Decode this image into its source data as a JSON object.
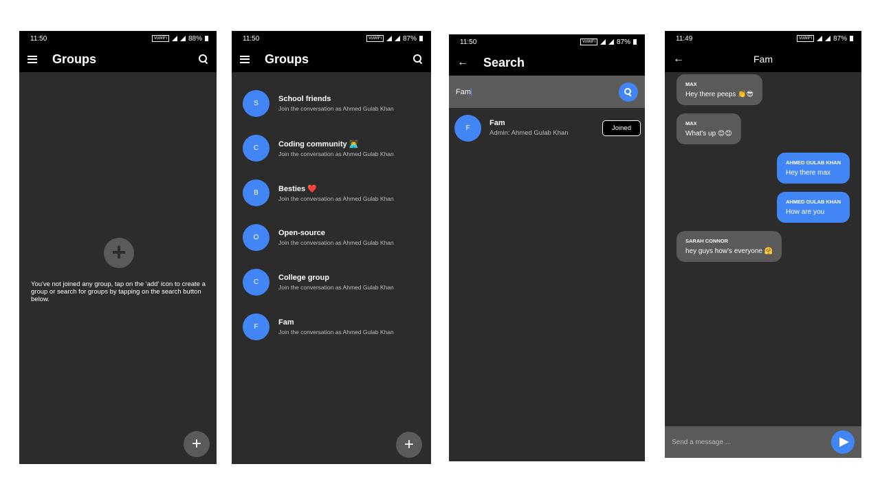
{
  "screen1": {
    "time": "11:50",
    "wifi_label": "VoWiFi",
    "battery": "88%",
    "title": "Groups",
    "empty_message": "You've not joined any group, tap on the 'add' icon to create a group or search for groups by tapping on the search button below.",
    "add_icon": "+",
    "fab_icon": "+"
  },
  "screen2": {
    "time": "11:50",
    "wifi_label": "VoWiFi",
    "battery": "87%",
    "title": "Groups",
    "fab_icon": "+",
    "groups": [
      {
        "initial": "S",
        "name": "School friends",
        "subtitle": "Join the conversation as Ahmed Gulab Khan"
      },
      {
        "initial": "C",
        "name": "Coding community 👨‍💻",
        "subtitle": "Join the conversation as Ahmed Gulab Khan"
      },
      {
        "initial": "B",
        "name": "Besties ❤️",
        "subtitle": "Join the conversation as Ahmed Gulab Khan"
      },
      {
        "initial": "O",
        "name": "Open-source",
        "subtitle": "Join the conversation as Ahmed Gulab Khan"
      },
      {
        "initial": "C",
        "name": "College group",
        "subtitle": "Join the conversation as Ahmed Gulab Khan"
      },
      {
        "initial": "F",
        "name": "Fam",
        "subtitle": "Join the conversation as Ahmed Gulab Khan"
      }
    ]
  },
  "screen3": {
    "time": "11:50",
    "wifi_label": "VoWiFi",
    "battery": "87%",
    "title": "Search",
    "back_icon": "←",
    "search_value": "Fam",
    "result": {
      "initial": "F",
      "name": "Fam",
      "admin": "Admin: Ahmed Gulab Khan",
      "button": "Joined"
    }
  },
  "screen4": {
    "time": "11:49",
    "wifi_label": "VoWiFi",
    "battery": "87%",
    "title": "Fam",
    "back_icon": "←",
    "messages": [
      {
        "sender": "MAX",
        "text": "Hey there peeps 👏😎",
        "direction": "in"
      },
      {
        "sender": "MAX",
        "text": "What's up 😊😊",
        "direction": "in"
      },
      {
        "sender": "AHMED GULAB KHAN",
        "text": "Hey there max",
        "direction": "out"
      },
      {
        "sender": "AHMED GULAB KHAN",
        "text": "How are you",
        "direction": "out"
      },
      {
        "sender": "SARAH CONNOR",
        "text": "hey guys how's everyone 🤗",
        "direction": "in"
      }
    ],
    "composer_placeholder": "Send a message ..."
  },
  "colors": {
    "accent": "#4285f4",
    "background": "#2c2c2c",
    "appbar": "#000000",
    "bubble_in": "#5a5a5a"
  }
}
